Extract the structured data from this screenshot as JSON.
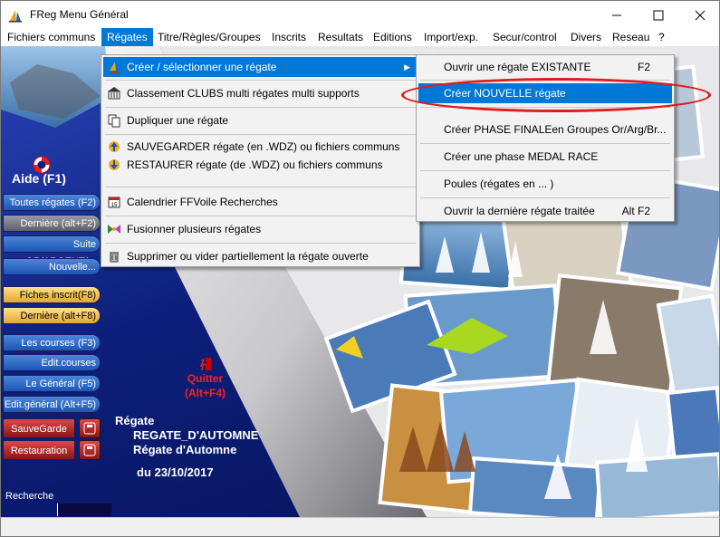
{
  "window": {
    "title": "FReg  Menu Général",
    "controls": [
      "minimize",
      "maximize",
      "close"
    ]
  },
  "menubar": {
    "items": [
      {
        "label": "Fichiers communs"
      },
      {
        "label": "Régates",
        "active": true
      },
      {
        "label": "Titre/Règles/Groupes"
      },
      {
        "label": "Inscrits"
      },
      {
        "label": "Resultats"
      },
      {
        "label": "Editions"
      },
      {
        "label": "Import/exp."
      },
      {
        "label": "Secur/control"
      },
      {
        "label": "Divers"
      },
      {
        "label": "Reseau"
      },
      {
        "label": "?"
      }
    ]
  },
  "regates_menu": {
    "items": [
      {
        "label": "Créer / sélectionner une régate",
        "icon": "sailboat-icon",
        "highlighted": true,
        "submenu": true
      },
      {
        "label": "Classement CLUBS multi régates multi supports",
        "icon": "building-icon"
      },
      {
        "label": "Dupliquer une régate",
        "icon": "copy-icon"
      },
      {
        "label": "SAUVEGARDER régate (en .WDZ) ou fichiers communs",
        "icon": "save-icon"
      },
      {
        "label": "RESTAURER régate (de .WDZ) ou fichiers communs",
        "icon": "restore-icon"
      },
      {
        "label": "Calendrier FFVoile Recherches",
        "icon": "calendar-icon"
      },
      {
        "label": "Fusionner plusieurs régates",
        "icon": "merge-icon"
      },
      {
        "label": "Supprimer ou vider partiellement la régate ouverte",
        "icon": "trash-icon"
      }
    ]
  },
  "submenu": {
    "items": [
      {
        "label": "Ouvrir une régate EXISTANTE",
        "shortcut": "F2"
      },
      {
        "label": "Créer NOUVELLE régate",
        "highlighted": true
      },
      {
        "label": "Créer PHASE FINALEen Groupes Or/Arg/Br..."
      },
      {
        "label": "Créer une phase MEDAL RACE"
      },
      {
        "label": "Poules (régates en ... )"
      },
      {
        "label": "Ouvrir la dernière régate traitée",
        "shortcut": "Alt F2"
      }
    ]
  },
  "sidebar": {
    "aide": "Aide  (F1)",
    "buttons": [
      {
        "label": "Toutes régates (F2)",
        "style": "blue"
      },
      {
        "label": "Dernière   (alt+F2)",
        "style": "gray"
      },
      {
        "label": "Suite OR/ARGENT/...",
        "style": "blue"
      },
      {
        "label": "Nouvelle...",
        "style": "blue"
      },
      {
        "label": "Fiches inscrit(F8)",
        "style": "gold"
      },
      {
        "label": "Dernière (alt+F8)",
        "style": "gold"
      },
      {
        "label": "Les courses  (F3)",
        "style": "blue"
      },
      {
        "label": "Edit.courses (Alt+F3)",
        "style": "blue"
      },
      {
        "label": "Le Général  (F5)",
        "style": "blue"
      },
      {
        "label": "Edit.général (Alt+F5)",
        "style": "blue"
      },
      {
        "label": "SauveGarde",
        "style": "red"
      },
      {
        "label": "Restauration",
        "style": "red"
      }
    ],
    "recherche": "Recherche"
  },
  "quit": {
    "line1": "Quitter",
    "line2": "(Alt+F4)"
  },
  "regate": {
    "label": "Régate",
    "code": "REGATE_D'AUTOMNE",
    "name": "Régate d'Automne",
    "date": "du 23/10/2017"
  },
  "colors": {
    "accent": "#0078d7",
    "highlight_ellipse": "#e01b1b",
    "background_blue": "#0c1f7a"
  }
}
